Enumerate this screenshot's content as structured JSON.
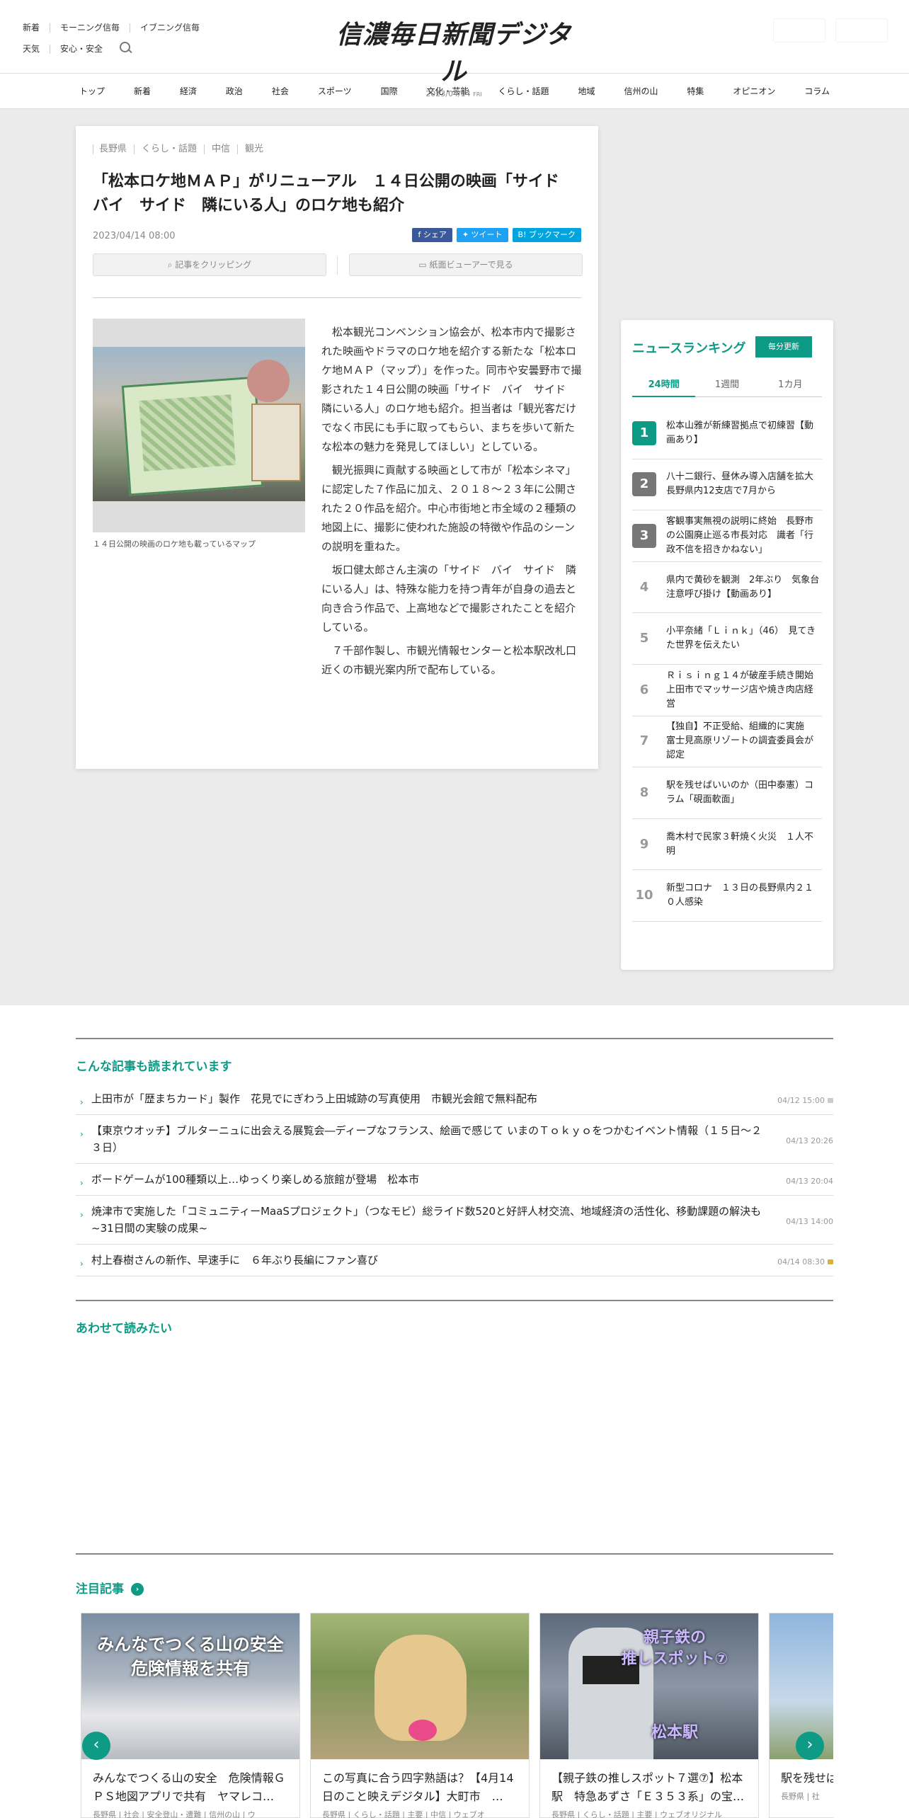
{
  "header": {
    "links_row1": [
      "新着",
      "モーニング信毎",
      "イブニング信毎"
    ],
    "links_row2": [
      "天気",
      "安心・安全"
    ],
    "logo_text": "信濃毎日新聞デジタル",
    "date": "2023/04/14",
    "weekday": "FRI"
  },
  "nav": [
    "トップ",
    "新着",
    "経済",
    "政治",
    "社会",
    "スポーツ",
    "国際",
    "文化・芸能",
    "くらし・話題",
    "地域",
    "信州の山",
    "特集",
    "オピニオン",
    "コラム"
  ],
  "article": {
    "tags": [
      "長野県",
      "くらし・話題",
      "中信",
      "観光"
    ],
    "title": "「松本ロケ地ＭＡＰ」がリニューアル　１４日公開の映画「サイド　バイ　サイド　隣にいる人」のロケ地も紹介",
    "date": "2023/04/14 08:00",
    "share": {
      "facebook": "シェア",
      "twitter": "ツイート",
      "hatena": "ブックマーク"
    },
    "clip_label": "記事をクリッピング",
    "viewer_label": "紙面ビューアーで見る",
    "caption": "１４日公開の映画のロケ地も載っているマップ",
    "paragraphs": [
      "松本観光コンベンション協会が、松本市内で撮影された映画やドラマのロケ地を紹介する新たな「松本ロケ地ＭＡＰ（マップ）」を作った。同市や安曇野市で撮影された１４日公開の映画「サイド　バイ　サイド　隣にいる人」のロケ地も紹介。担当者は「観光客だけでなく市民にも手に取ってもらい、まちを歩いて新たな松本の魅力を発見してほしい」としている。",
      "観光振興に貢献する映画として市が「松本シネマ」に認定した７作品に加え、２０１８～２３年に公開された２０作品を紹介。中心市街地と市全域の２種類の地図上に、撮影に使われた施設の特徴や作品のシーンの説明を重ねた。",
      "坂口健太郎さん主演の「サイド　バイ　サイド　隣にいる人」は、特殊な能力を持つ青年が自身の過去と向き合う作品で、上高地などで撮影されたことを紹介している。",
      "７千部作製し、市観光情報センターと松本駅改札口近くの市観光案内所で配布している。"
    ]
  },
  "ranking": {
    "title": "ニュースランキング",
    "badge": "毎分更新",
    "tabs": [
      "24時間",
      "1週間",
      "1カ月"
    ],
    "items": [
      {
        "num": "1",
        "text": "松本山雅が新練習拠点で初練習【動画あり】"
      },
      {
        "num": "2",
        "text": "八十二銀行、昼休み導入店舗を拡大　長野県内12支店で7月から"
      },
      {
        "num": "3",
        "text": "客観事実無視の説明に終始　長野市の公園廃止巡る市長対応　識者「行政不信を招きかねない」"
      },
      {
        "num": "4",
        "text": "県内で黄砂を観測　2年ぶり　気象台注意呼び掛け【動画あり】"
      },
      {
        "num": "5",
        "text": "小平奈緒「Ｌｉｎｋ」（46）　見てきた世界を伝えたい"
      },
      {
        "num": "6",
        "text": "Ｒｉｓｉｎｇ１４が破産手続き開始　上田市でマッサージ店や焼き肉店経営"
      },
      {
        "num": "7",
        "text": "【独自】不正受給、組織的に実施　富士見高原リゾートの調査委員会が認定"
      },
      {
        "num": "8",
        "text": "駅を残せばいいのか（田中泰憲）コラム「硯面軟面」"
      },
      {
        "num": "9",
        "text": "喬木村で民家３軒焼く火災　１人不明"
      },
      {
        "num": "10",
        "text": "新型コロナ　１３日の長野県内２１０人感染"
      }
    ]
  },
  "related": {
    "title": "こんな記事も読まれています",
    "items": [
      {
        "text": "上田市が「歴まちカード」製作　花見でにぎわう上田城跡の写真使用　市観光会館で無料配布",
        "time": "04/12 15:00",
        "lock": "grey"
      },
      {
        "text": "【東京ウオッチ】ブルターニュに出会える展覧会―ディープなフランス、絵画で感じて いまのＴｏｋｙｏをつかむイベント情報（１５日～２３日）",
        "time": "04/13 20:26",
        "lock": ""
      },
      {
        "text": "ボードゲームが100種類以上…ゆっくり楽しめる旅館が登場　松本市",
        "time": "04/13 20:04",
        "lock": ""
      },
      {
        "text": "焼津市で実施した「コミュニティーMaaSプロジェクト」（つなモビ）総ライド数520と好評人材交流、地域経済の活性化、移動課題の解決も　~31日間の実験の成果~",
        "time": "04/13 14:00",
        "lock": ""
      },
      {
        "text": "村上春樹さんの新作、早速手に　６年ぶり長編にファン喜び",
        "time": "04/14 08:30",
        "lock": "gold"
      }
    ]
  },
  "also_read": {
    "title": "あわせて読みたい"
  },
  "featured": {
    "title": "注目記事",
    "cards": [
      {
        "img_text": [
          "みんなでつくる山の安全",
          "危険情報を共有"
        ],
        "title": "みんなでつくる山の安全　危険情報ＧＰＳ地図アプリで共有　ヤマレコ…",
        "tags": "長野県 | 社会 | 安全登山・遭難 | 信州の山 | ウ"
      },
      {
        "img_text": [],
        "title": "この写真に合う四字熟語は？【4月14日のこと映えデジタル】大町市　…",
        "tags": "長野県 | くらし・話題 | 主要 | 中信 | ウェブオ"
      },
      {
        "img_text": [
          "親子鉄の",
          "推しスポット⑦",
          "松本駅"
        ],
        "title": "【親子鉄の推しスポット７選⑦】松本駅　特急あずさ「Ｅ３５３系」の宝…",
        "tags": "長野県 | くらし・話題 | 主要 | ウェブオリジナル"
      },
      {
        "img_text": [],
        "title": "駅を残せば…ム「硯面軟",
        "tags": "長野県 | 社"
      }
    ]
  },
  "colors": {
    "accent": "#0d9b86",
    "facebook": "#3b5998",
    "twitter": "#1da1f2",
    "hatena": "#00a4de"
  }
}
